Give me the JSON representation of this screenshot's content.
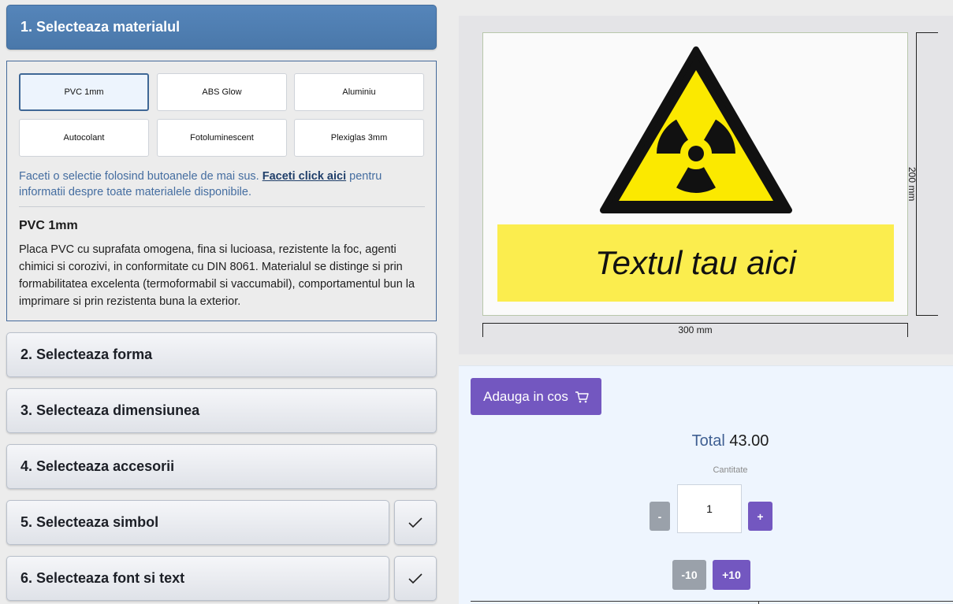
{
  "steps": {
    "s1": "1. Selecteaza materialul",
    "s2": "2. Selecteaza forma",
    "s3": "3. Selecteaza dimensiunea",
    "s4": "4. Selecteaza accesorii",
    "s5": "5. Selecteaza simbol",
    "s6": "6. Selecteaza font si text"
  },
  "materials": [
    "PVC 1mm",
    "ABS Glow",
    "Aluminiu",
    "Autocolant",
    "Fotoluminescent",
    "Plexiglas 3mm"
  ],
  "selected_material": "PVC 1mm",
  "info": {
    "before": "Faceti o selectie folosind butoanele de mai sus. ",
    "link": "Faceti click aici",
    "after": " pentru informatii despre toate materialele disponibile."
  },
  "material_detail": {
    "title": "PVC 1mm",
    "description": "Placa PVC cu suprafata omogena, fina si lucioasa, rezistente la foc, agenti chimici si corozivi, in conformitate cu DIN 8061. Materialul se distinge si prin formabilitatea excelenta (termoformabil si vaccumabil), comportamentul bun la imprimare si prin rezistenta buna la exterior."
  },
  "preview": {
    "sign_text": "Textul tau aici",
    "height_label": "200 mm",
    "width_label": "300 mm",
    "symbol": "radiation-warning-icon"
  },
  "cart": {
    "add_label": "Adauga in cos",
    "total_label": "Total",
    "total_value": "43.00",
    "quantity_label": "Cantitate",
    "quantity": "1",
    "minus": "-",
    "plus": "+",
    "minus10": "-10",
    "plus10": "+10"
  },
  "colors": {
    "step_active": "#4f7fb4",
    "accent_purple": "#7357c0",
    "minus_gray": "#9aa1aa",
    "warning_yellow": "#fbe900",
    "text_band": "#fbed4e"
  }
}
